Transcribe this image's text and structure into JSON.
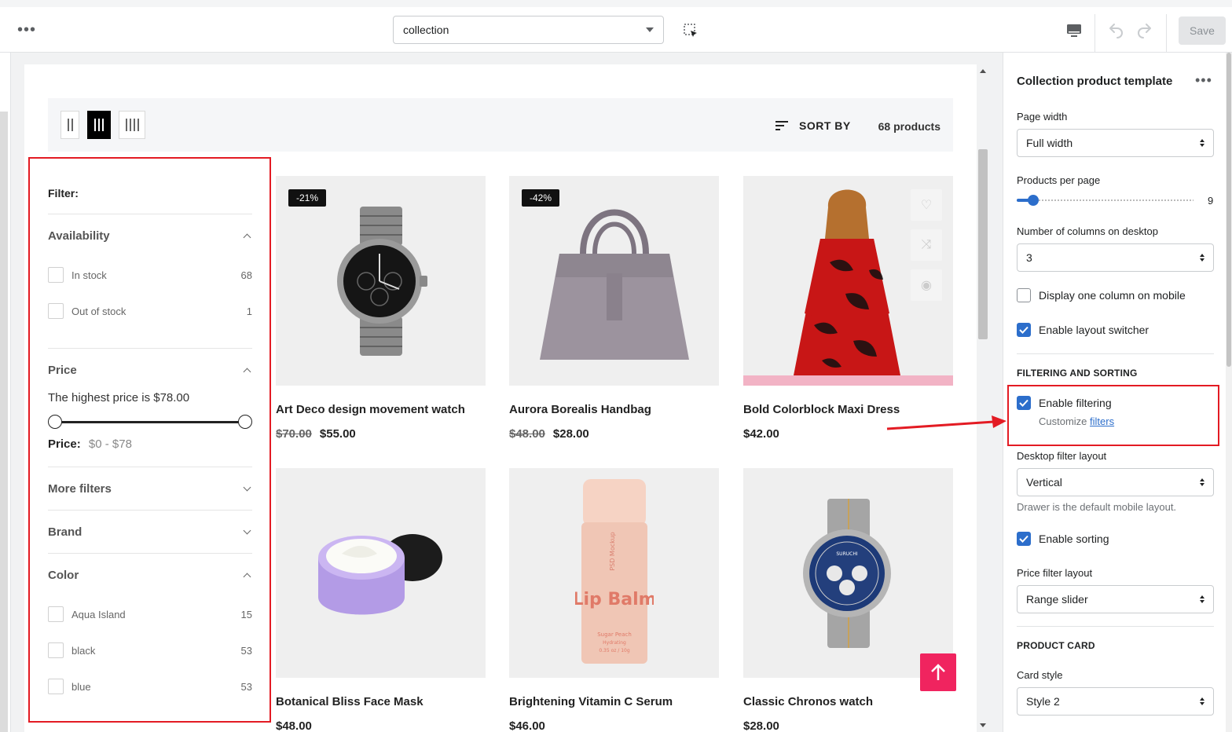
{
  "topbar": {
    "more_label": "•••",
    "template_select": "collection",
    "save_label": "Save"
  },
  "toolbar": {
    "sort_label": "SORT BY",
    "product_count": "68 products"
  },
  "filters": {
    "title": "Filter:",
    "availability": {
      "label": "Availability",
      "options": [
        {
          "label": "In stock",
          "count": "68"
        },
        {
          "label": "Out of stock",
          "count": "1"
        }
      ]
    },
    "price": {
      "label": "Price",
      "highest_text": "The highest price is $78.00",
      "range_label": "Price:",
      "range_value": "$0 - $78"
    },
    "more_filters": "More filters",
    "brand": "Brand",
    "color": {
      "label": "Color",
      "options": [
        {
          "label": "Aqua Island",
          "count": "15"
        },
        {
          "label": "black",
          "count": "53"
        },
        {
          "label": "blue",
          "count": "53"
        }
      ]
    }
  },
  "products": [
    {
      "name": "Art Deco design movement watch",
      "old_price": "$70.00",
      "price": "$55.00",
      "badge": "-21%"
    },
    {
      "name": "Aurora Borealis Handbag",
      "old_price": "$48.00",
      "price": "$28.00",
      "badge": "-42%"
    },
    {
      "name": "Bold Colorblock Maxi Dress",
      "old_price": "",
      "price": "$42.00",
      "badge": ""
    },
    {
      "name": "Botanical Bliss Face Mask",
      "old_price": "",
      "price": "$48.00",
      "badge": ""
    },
    {
      "name": "Brightening Vitamin C Serum",
      "old_price": "",
      "price": "$46.00",
      "badge": ""
    },
    {
      "name": "Classic Chronos watch",
      "old_price": "",
      "price": "$28.00",
      "badge": ""
    }
  ],
  "product_art": {
    "mockup_text": "PSD Mockup",
    "lip_title": "Lip Balm",
    "lip_sub": "Sugar Peach",
    "lip_sub2": "Hydrating",
    "lip_weight": "0.35 oz / 10g",
    "watch_brand": "SURUCHI"
  },
  "panel": {
    "title": "Collection product template",
    "more_label": "•••",
    "page_width_label": "Page width",
    "page_width_value": "Full width",
    "products_per_page_label": "Products per page",
    "products_per_page_value": "9",
    "columns_label": "Number of columns on desktop",
    "columns_value": "3",
    "one_column_mobile": "Display one column on mobile",
    "layout_switcher": "Enable layout switcher",
    "filtering_heading": "FILTERING AND SORTING",
    "enable_filtering": "Enable filtering",
    "customize_text": "Customize",
    "customize_link": "filters",
    "desktop_filter_label": "Desktop filter layout",
    "desktop_filter_value": "Vertical",
    "drawer_help": "Drawer is the default mobile layout.",
    "enable_sorting": "Enable sorting",
    "price_filter_label": "Price filter layout",
    "price_filter_value": "Range slider",
    "product_card_heading": "PRODUCT CARD",
    "card_style_label": "Card style",
    "card_style_value": "Style 2"
  },
  "colors": {
    "accent_blue": "#2c6ecb",
    "annotation_red": "#e31b23",
    "back_to_top": "#f0245f"
  }
}
